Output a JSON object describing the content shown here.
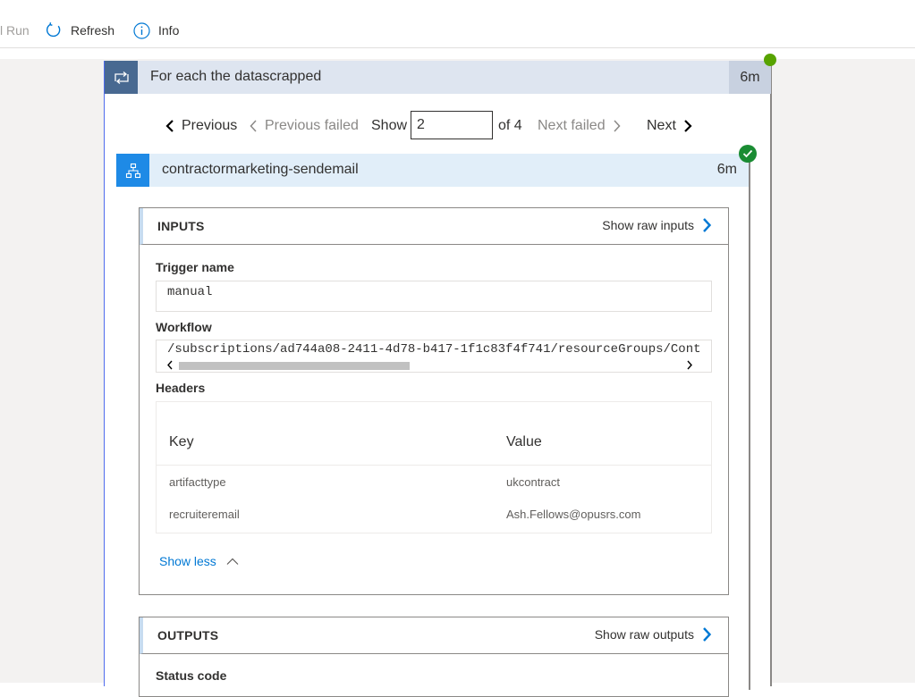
{
  "toolbar": {
    "run_label": "l Run",
    "refresh_label": "Refresh",
    "info_label": "Info"
  },
  "foreach": {
    "title": "For each the datascrapped",
    "duration": "6m",
    "status": "succeeded"
  },
  "pager": {
    "previous_label": "Previous",
    "previous_failed_label": "Previous failed",
    "show_label": "Show",
    "current_value": "2",
    "of_label": "of 4",
    "next_failed_label": "Next failed",
    "next_label": "Next"
  },
  "action": {
    "title": "contractormarketing-sendemail",
    "duration": "6m",
    "status": "succeeded"
  },
  "inputs": {
    "title": "INPUTS",
    "raw_label": "Show raw inputs",
    "trigger_name_label": "Trigger name",
    "trigger_name_value": "manual",
    "workflow_label": "Workflow",
    "workflow_value": "/subscriptions/ad744a08-2411-4d78-b417-1f1c83f4f741/resourceGroups/Cont",
    "headers_label": "Headers",
    "headers_columns": [
      "Key",
      "Value"
    ],
    "headers_rows": [
      {
        "key": "artifacttype",
        "value": "ukcontract"
      },
      {
        "key": "recruiteremail",
        "value": "Ash.Fellows@opusrs.com"
      }
    ],
    "show_less_label": "Show less"
  },
  "outputs": {
    "title": "OUTPUTS",
    "raw_label": "Show raw outputs",
    "status_code_label": "Status code"
  },
  "colors": {
    "accent": "#0078d4",
    "success": "#1a8c33",
    "loop_header": "#dee5f0",
    "action_header": "#e1eef9"
  }
}
